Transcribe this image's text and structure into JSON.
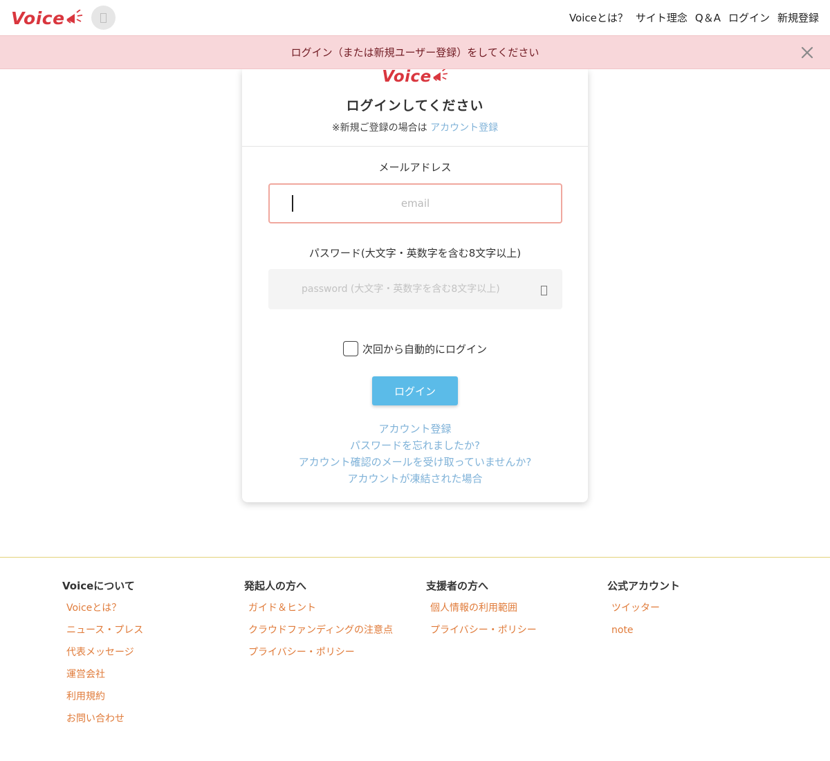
{
  "header": {
    "logo": "Voice",
    "nav": [
      "Voiceとは？",
      "サイト理念",
      "Q＆A",
      "ログイン",
      "新規登録"
    ]
  },
  "alert": {
    "message": "ログイン（または新規ユーザー登録）をしてください"
  },
  "card": {
    "logo": "Voice",
    "title": "ログインしてください",
    "subtitle_prefix": "※新規ご登録の場合は",
    "subtitle_link": "アカウント登録",
    "email_label": "メールアドレス",
    "email_placeholder": "email",
    "email_value": "",
    "password_label": "パスワード(大文字・英数字を含む8文字以上)",
    "password_placeholder": "password (大文字・英数字を含む8文字以上)",
    "remember_label": "次回から自動的にログイン",
    "login_button": "ログイン",
    "links": [
      "アカウント登録",
      "パスワードを忘れましたか?",
      "アカウント確認のメールを受け取っていませんか?",
      "アカウントが凍結された場合"
    ]
  },
  "footer": {
    "columns": [
      {
        "heading": "Voiceについて",
        "links": [
          "Voiceとは？",
          "ニュース・プレス",
          "代表メッセージ",
          "運営会社",
          "利用規約",
          "お問い合わせ"
        ]
      },
      {
        "heading": "発起人の方へ",
        "links": [
          "ガイド＆ヒント",
          "クラウドファンディングの注意点",
          "プライバシー・ポリシー"
        ]
      },
      {
        "heading": "支援者の方へ",
        "links": [
          "個人情報の利用範囲",
          "プライバシー・ポリシー"
        ]
      },
      {
        "heading": "公式アカウント",
        "links": [
          "ツイッター",
          "note"
        ]
      }
    ]
  },
  "colors": {
    "brand": "#d9363e",
    "alert_bg": "#f8d7da",
    "login_button": "#5bbbe8",
    "link": "#7fb2d8",
    "footer_link": "#e07b3a"
  }
}
